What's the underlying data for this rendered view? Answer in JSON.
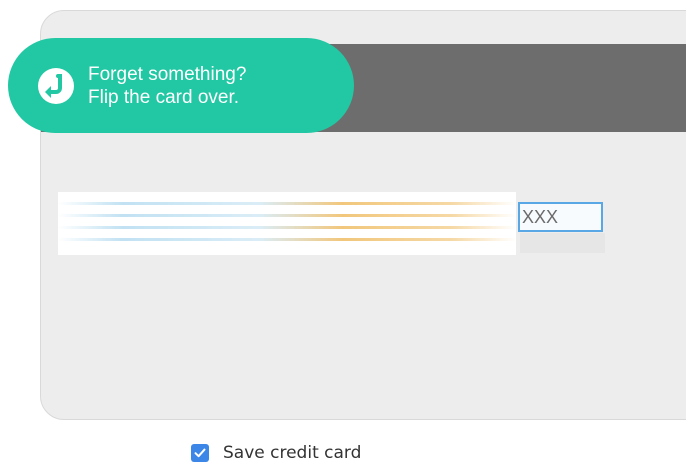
{
  "tooltip": {
    "icon": "return-arrow-icon",
    "line1": "Forget something?",
    "line2": "Flip the card over."
  },
  "card_back": {
    "cvv_placeholder": "XXX"
  },
  "save_card": {
    "checked": true,
    "label": "Save credit card"
  },
  "colors": {
    "tooltip_background": "#22c7a3",
    "card_background": "#ededed",
    "magnetic_stripe": "#6d6d6d",
    "checkbox_accent": "#3b86e6",
    "input_focus_border": "#5aa7e6"
  }
}
